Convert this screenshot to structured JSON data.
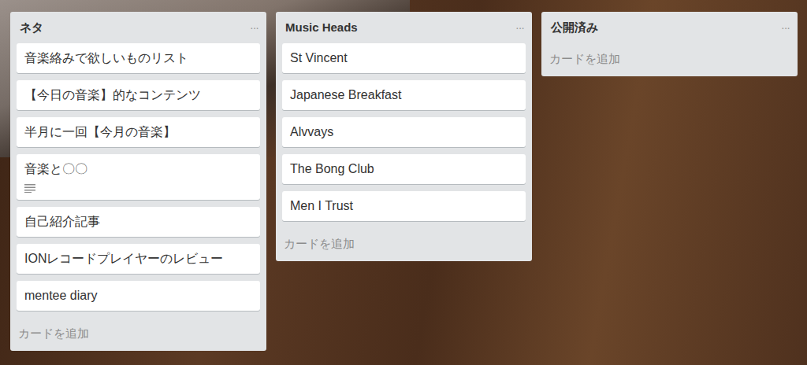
{
  "board": {
    "lists": [
      {
        "title": "ネタ",
        "menu": "···",
        "add_card": "カードを追加",
        "cards": [
          {
            "text": "音楽絡みで欲しいものリスト",
            "has_description": false
          },
          {
            "text": "【今日の音楽】的なコンテンツ",
            "has_description": false
          },
          {
            "text": "半月に一回【今月の音楽】",
            "has_description": false
          },
          {
            "text": "音楽と〇〇",
            "has_description": true
          },
          {
            "text": "自己紹介記事",
            "has_description": false
          },
          {
            "text": "IONレコードプレイヤーのレビュー",
            "has_description": false
          },
          {
            "text": "mentee diary",
            "has_description": false
          }
        ]
      },
      {
        "title": "Music Heads",
        "menu": "···",
        "add_card": "カードを追加",
        "cards": [
          {
            "text": "St Vincent",
            "has_description": false
          },
          {
            "text": "Japanese Breakfast",
            "has_description": false
          },
          {
            "text": "Alvvays",
            "has_description": false
          },
          {
            "text": "The Bong Club",
            "has_description": false
          },
          {
            "text": "Men I Trust",
            "has_description": false
          }
        ]
      },
      {
        "title": "公開済み",
        "menu": "···",
        "add_card": "カードを追加",
        "cards": []
      }
    ]
  }
}
